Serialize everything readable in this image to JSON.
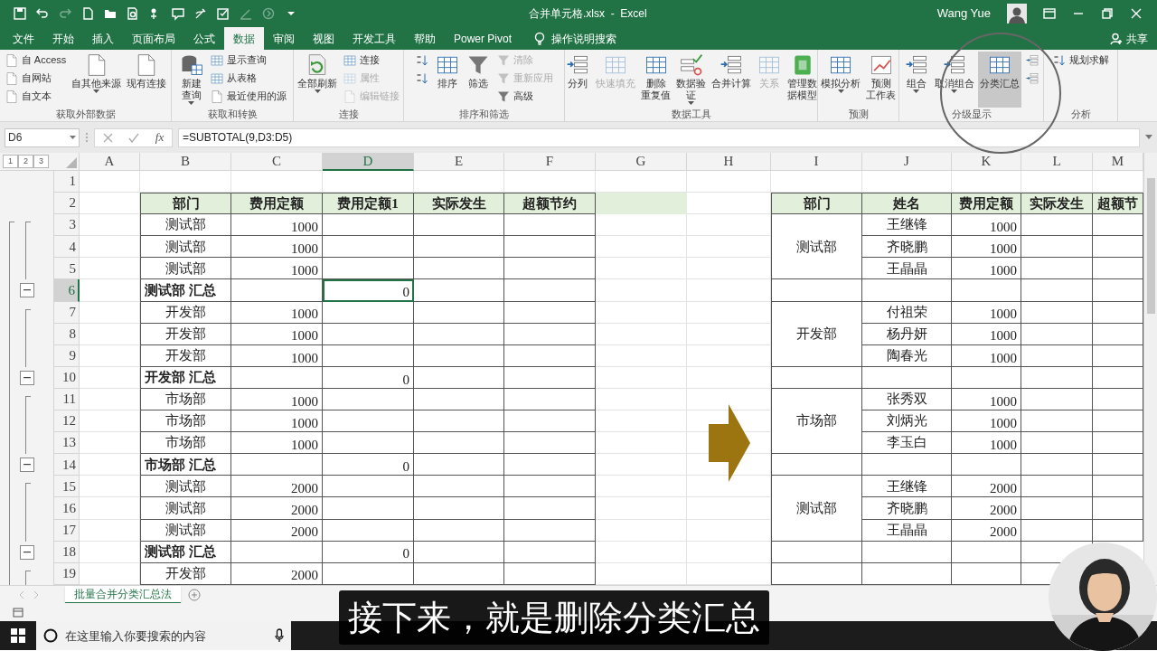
{
  "title_bar": {
    "document_title": "合并单元格.xlsx  -  Excel",
    "user_name": "Wang Yue"
  },
  "ribbon_tabs": [
    {
      "label": "文件",
      "selected": false
    },
    {
      "label": "开始",
      "selected": false
    },
    {
      "label": "插入",
      "selected": false
    },
    {
      "label": "页面布局",
      "selected": false
    },
    {
      "label": "公式",
      "selected": false
    },
    {
      "label": "数据",
      "selected": true
    },
    {
      "label": "审阅",
      "selected": false
    },
    {
      "label": "视图",
      "selected": false
    },
    {
      "label": "开发工具",
      "selected": false
    },
    {
      "label": "帮助",
      "selected": false
    },
    {
      "label": "Power Pivot",
      "selected": false
    }
  ],
  "tell_me": "操作说明搜索",
  "share": "共享",
  "ribbon_groups": [
    {
      "label": "获取外部数据",
      "buttons": [
        {
          "kind": "small",
          "label": "自 Access",
          "disabled": false,
          "hovered": false,
          "dropdown": false
        },
        {
          "kind": "small",
          "label": "自网站",
          "disabled": false,
          "hovered": false,
          "dropdown": false
        },
        {
          "kind": "small",
          "label": "自文本",
          "disabled": false,
          "hovered": false,
          "dropdown": false
        },
        {
          "kind": "large",
          "label": "自其他来源",
          "disabled": false,
          "hovered": false,
          "dropdown": true
        },
        {
          "kind": "large",
          "label": "现有连接",
          "disabled": false,
          "hovered": false,
          "dropdown": false
        }
      ]
    },
    {
      "label": "获取和转换",
      "buttons": [
        {
          "kind": "large",
          "lines": [
            "新建",
            "查询"
          ],
          "disabled": false,
          "hovered": false,
          "dropdown": true
        },
        {
          "kind": "small",
          "label": "显示查询",
          "disabled": false,
          "hovered": false,
          "dropdown": false
        },
        {
          "kind": "small",
          "label": "从表格",
          "disabled": false,
          "hovered": false,
          "dropdown": false
        },
        {
          "kind": "small",
          "label": "最近使用的源",
          "disabled": false,
          "hovered": false,
          "dropdown": false
        }
      ]
    },
    {
      "label": "连接",
      "buttons": [
        {
          "kind": "large",
          "label": "全部刷新",
          "disabled": false,
          "hovered": false,
          "dropdown": true
        },
        {
          "kind": "small",
          "label": "连接",
          "disabled": false,
          "hovered": false,
          "dropdown": false
        },
        {
          "kind": "small",
          "label": "属性",
          "disabled": true,
          "hovered": false,
          "dropdown": false
        },
        {
          "kind": "small",
          "label": "编辑链接",
          "disabled": true,
          "hovered": false,
          "dropdown": false
        }
      ]
    },
    {
      "label": "排序和筛选",
      "buttons": [
        {
          "kind": "small",
          "disabled": false,
          "hovered": false,
          "dropdown": false
        },
        {
          "kind": "small",
          "disabled": false,
          "hovered": false,
          "dropdown": false
        },
        {
          "kind": "large",
          "label": "排序",
          "disabled": false,
          "hovered": false,
          "dropdown": false
        },
        {
          "kind": "large",
          "label": "筛选",
          "disabled": false,
          "hovered": false,
          "dropdown": false
        },
        {
          "kind": "small",
          "label": "清除",
          "disabled": true,
          "hovered": false,
          "dropdown": false
        },
        {
          "kind": "small",
          "label": "重新应用",
          "disabled": true,
          "hovered": false,
          "dropdown": false
        },
        {
          "kind": "small",
          "label": "高级",
          "disabled": false,
          "hovered": false,
          "dropdown": false
        }
      ]
    },
    {
      "label": "数据工具",
      "buttons": [
        {
          "kind": "large",
          "label": "分列",
          "disabled": false,
          "hovered": false,
          "dropdown": false
        },
        {
          "kind": "large",
          "label": "快速填充",
          "disabled": true,
          "hovered": false,
          "dropdown": false
        },
        {
          "kind": "large",
          "lines": [
            "删除",
            "重复值"
          ],
          "disabled": false,
          "hovered": false,
          "dropdown": false
        },
        {
          "kind": "large",
          "lines": [
            "数据验",
            "证"
          ],
          "disabled": false,
          "hovered": false,
          "dropdown": true
        },
        {
          "kind": "large",
          "label": "合并计算",
          "disabled": false,
          "hovered": false,
          "dropdown": false
        },
        {
          "kind": "large",
          "label": "关系",
          "disabled": true,
          "hovered": false,
          "dropdown": false
        },
        {
          "kind": "large",
          "lines": [
            "管理数",
            "据模型"
          ],
          "disabled": false,
          "hovered": false,
          "dropdown": false
        }
      ]
    },
    {
      "label": "预测",
      "buttons": [
        {
          "kind": "large",
          "label": "模拟分析",
          "disabled": false,
          "hovered": false,
          "dropdown": true
        },
        {
          "kind": "large",
          "lines": [
            "预测",
            "工作表"
          ],
          "disabled": false,
          "hovered": false,
          "dropdown": false
        }
      ]
    },
    {
      "label": "分级显示",
      "buttons": [
        {
          "kind": "large",
          "label": "组合",
          "disabled": false,
          "hovered": false,
          "dropdown": true
        },
        {
          "kind": "large",
          "label": "取消组合",
          "disabled": false,
          "hovered": false,
          "dropdown": true
        },
        {
          "kind": "large",
          "label": "分类汇总",
          "disabled": false,
          "hovered": true,
          "dropdown": false
        },
        {
          "kind": "small",
          "disabled": false,
          "hovered": false,
          "dropdown": false
        },
        {
          "kind": "small",
          "disabled": false,
          "hovered": false,
          "dropdown": false
        }
      ]
    },
    {
      "label": "分析",
      "buttons": [
        {
          "kind": "small",
          "label": "规划求解",
          "disabled": false,
          "hovered": false,
          "dropdown": false
        }
      ]
    }
  ],
  "formula_bar": {
    "name_box": "D6",
    "fx": "fx",
    "formula": "=SUBTOTAL(9,D3:D5)"
  },
  "outline_levels": [
    "1",
    "2",
    "3"
  ],
  "columns": [
    {
      "label": "A",
      "selected": false
    },
    {
      "label": "B",
      "selected": false
    },
    {
      "label": "C",
      "selected": false
    },
    {
      "label": "D",
      "selected": true
    },
    {
      "label": "E",
      "selected": false
    },
    {
      "label": "F",
      "selected": false
    },
    {
      "label": "G",
      "selected": false
    },
    {
      "label": "H",
      "selected": false
    },
    {
      "label": "I",
      "selected": false
    },
    {
      "label": "J",
      "selected": false
    },
    {
      "label": "K",
      "selected": false
    },
    {
      "label": "L",
      "selected": false
    },
    {
      "label": "M",
      "selected": false
    }
  ],
  "row_numbers": [
    {
      "label": "1",
      "selected": false
    },
    {
      "label": "2",
      "selected": false
    },
    {
      "label": "3",
      "selected": false
    },
    {
      "label": "4",
      "selected": false
    },
    {
      "label": "5",
      "selected": false
    },
    {
      "label": "6",
      "selected": true
    },
    {
      "label": "7",
      "selected": false
    },
    {
      "label": "8",
      "selected": false
    },
    {
      "label": "9",
      "selected": false
    },
    {
      "label": "10",
      "selected": false
    },
    {
      "label": "11",
      "selected": false
    },
    {
      "label": "12",
      "selected": false
    },
    {
      "label": "13",
      "selected": false
    },
    {
      "label": "14",
      "selected": false
    },
    {
      "label": "15",
      "selected": false
    },
    {
      "label": "16",
      "selected": false
    },
    {
      "label": "17",
      "selected": false
    },
    {
      "label": "18",
      "selected": false
    },
    {
      "label": "19",
      "selected": false
    }
  ],
  "left_table": {
    "headers": [
      "部门",
      "费用定额",
      "费用定额1",
      "实际发生",
      "超额节约"
    ],
    "rows": [
      {
        "kind": "detail",
        "dept": "测试部",
        "quota": "1000"
      },
      {
        "kind": "detail",
        "dept": "测试部",
        "quota": "1000"
      },
      {
        "kind": "detail",
        "dept": "测试部",
        "quota": "1000"
      },
      {
        "kind": "subtotal",
        "label": "测试部 汇总",
        "quota1": "0"
      },
      {
        "kind": "detail",
        "dept": "开发部",
        "quota": "1000"
      },
      {
        "kind": "detail",
        "dept": "开发部",
        "quota": "1000"
      },
      {
        "kind": "detail",
        "dept": "开发部",
        "quota": "1000"
      },
      {
        "kind": "subtotal",
        "label": "开发部 汇总",
        "quota1": "0"
      },
      {
        "kind": "detail",
        "dept": "市场部",
        "quota": "1000"
      },
      {
        "kind": "detail",
        "dept": "市场部",
        "quota": "1000"
      },
      {
        "kind": "detail",
        "dept": "市场部",
        "quota": "1000"
      },
      {
        "kind": "subtotal",
        "label": "市场部 汇总",
        "quota1": "0"
      },
      {
        "kind": "detail",
        "dept": "测试部",
        "quota": "2000"
      },
      {
        "kind": "detail",
        "dept": "测试部",
        "quota": "2000"
      },
      {
        "kind": "detail",
        "dept": "测试部",
        "quota": "2000"
      },
      {
        "kind": "subtotal",
        "label": "测试部 汇总",
        "quota1": "0"
      },
      {
        "kind": "detail",
        "dept": "开发部",
        "quota": "2000"
      }
    ]
  },
  "right_table": {
    "headers": [
      "部门",
      "姓名",
      "费用定额",
      "实际发生",
      "超额节"
    ],
    "groups": [
      {
        "dept": "测试部",
        "members": [
          {
            "name": "王继锋",
            "quota": "1000"
          },
          {
            "name": "齐晓鹏",
            "quota": "1000"
          },
          {
            "name": "王晶晶",
            "quota": "1000"
          }
        ]
      },
      {
        "dept": "开发部",
        "members": [
          {
            "name": "付祖荣",
            "quota": "1000"
          },
          {
            "name": "杨丹妍",
            "quota": "1000"
          },
          {
            "name": "陶春光",
            "quota": "1000"
          }
        ]
      },
      {
        "dept": "市场部",
        "members": [
          {
            "name": "张秀双",
            "quota": "1000"
          },
          {
            "name": "刘炳光",
            "quota": "1000"
          },
          {
            "name": "李玉白",
            "quota": "1000"
          }
        ]
      },
      {
        "dept": "测试部",
        "members": [
          {
            "name": "王继锋",
            "quota": "2000"
          },
          {
            "name": "齐晓鹏",
            "quota": "2000"
          },
          {
            "name": "王晶晶",
            "quota": "2000"
          }
        ]
      }
    ]
  },
  "sheet_tabs": [
    {
      "label": "批量合并分类汇总法",
      "selected": true
    }
  ],
  "taskbar": {
    "search_placeholder": "在这里输入你要搜索的内容"
  },
  "subtitle": "接下来，就是删除分类汇总"
}
